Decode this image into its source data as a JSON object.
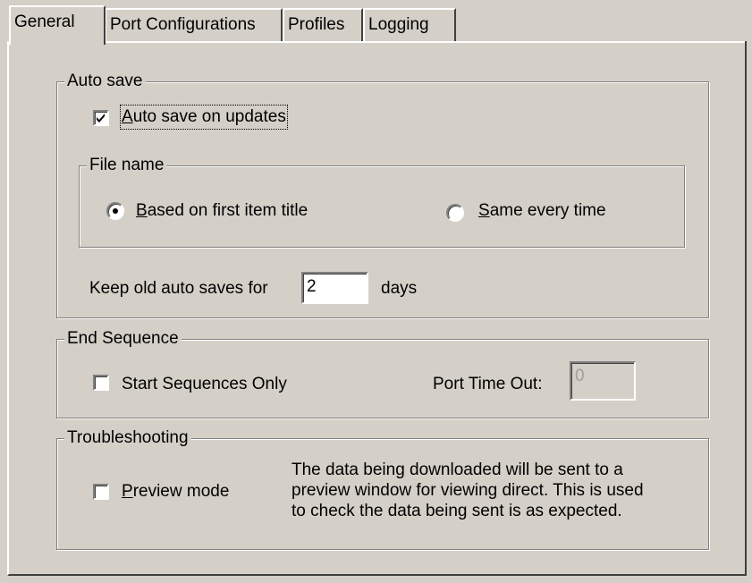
{
  "tabs": [
    {
      "label": "General",
      "active": true
    },
    {
      "label": "Port Configurations",
      "active": false
    },
    {
      "label": "Profiles",
      "active": false
    },
    {
      "label": "Logging",
      "active": false
    }
  ],
  "auto_save": {
    "title": "Auto save",
    "checkbox_prefix": "",
    "checkbox_accel": "A",
    "checkbox_rest": "uto save on updates",
    "checked": true,
    "file_name": {
      "title": "File name",
      "option1_accel": "B",
      "option1_rest": "ased on first item title",
      "option1_selected": true,
      "option2_accel": "S",
      "option2_rest": "ame every time",
      "option2_selected": false
    },
    "keep_label": "Keep old auto saves for",
    "keep_value": "2",
    "keep_unit": "days"
  },
  "end_sequence": {
    "title": "End Sequence",
    "start_only_label": "Start Sequences Only",
    "start_only_checked": false,
    "port_timeout_label": "Port Time Out:",
    "port_timeout_value": "0"
  },
  "troubleshooting": {
    "title": "Troubleshooting",
    "preview_accel": "P",
    "preview_rest": "review mode",
    "preview_checked": false,
    "description_lines": [
      "The data being downloaded will be sent to a",
      "preview window for viewing direct. This is used",
      "to check the data being sent is as expected."
    ]
  }
}
